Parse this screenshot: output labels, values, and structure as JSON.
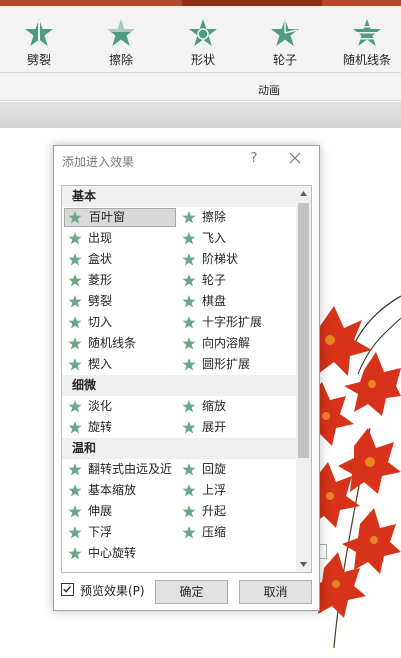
{
  "ribbon": {
    "items": [
      {
        "label": "劈裂",
        "icon": "split-star-icon"
      },
      {
        "label": "擦除",
        "icon": "wipe-star-icon"
      },
      {
        "label": "形状",
        "icon": "shape-star-icon"
      },
      {
        "label": "轮子",
        "icon": "wheel-star-icon"
      },
      {
        "label": "随机线条",
        "icon": "random-bars-star-icon"
      }
    ],
    "group_label": "动画",
    "accent_color": "#b7472a",
    "icon_color": "#4e9b7e"
  },
  "dialog": {
    "title": "添加进入效果",
    "help": "?",
    "categories": [
      {
        "name": "基本",
        "rows": [
          [
            "百叶窗",
            "擦除"
          ],
          [
            "出现",
            "飞入"
          ],
          [
            "盒状",
            "阶梯状"
          ],
          [
            "菱形",
            "轮子"
          ],
          [
            "劈裂",
            "棋盘"
          ],
          [
            "切入",
            "十字形扩展"
          ],
          [
            "随机线条",
            "向内溶解"
          ],
          [
            "楔入",
            "圆形扩展"
          ]
        ]
      },
      {
        "name": "细微",
        "rows": [
          [
            "淡化",
            "缩放"
          ],
          [
            "旋转",
            "展开"
          ]
        ]
      },
      {
        "name": "温和",
        "rows": [
          [
            "翻转式由远及近",
            "回旋"
          ],
          [
            "基本缩放",
            "上浮"
          ],
          [
            "伸展",
            "升起"
          ],
          [
            "下浮",
            "压缩"
          ],
          [
            "中心旋转",
            ""
          ]
        ]
      }
    ],
    "selected_effect": "百叶窗",
    "preview_label": "预览效果(P)",
    "preview_checked": true,
    "ok_label": "确定",
    "cancel_label": "取消",
    "star_color": "#6aa888"
  }
}
